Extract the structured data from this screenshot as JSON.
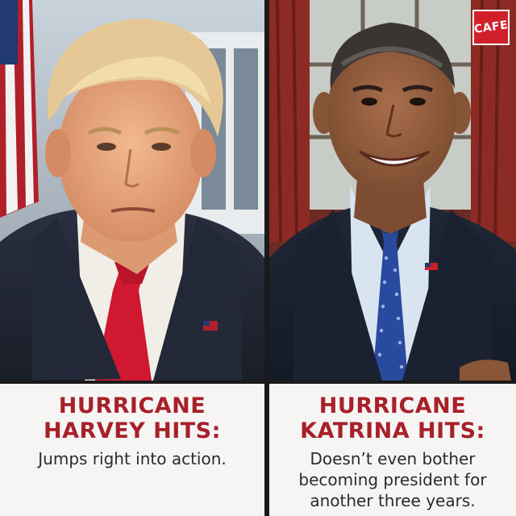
{
  "logo": {
    "text": "CAFE",
    "color": "#d0202a"
  },
  "panels": [
    {
      "headline_line1": "HURRICANE",
      "headline_line2": "HARVEY HITS:",
      "subtext": [
        "Jumps right into action."
      ]
    },
    {
      "headline_line1": "HURRICANE",
      "headline_line2": "KATRINA HITS:",
      "subtext": [
        "Doesn’t even bother",
        "becoming president for",
        "another three years."
      ]
    }
  ],
  "colors": {
    "headline": "#a8202a",
    "caption_bg": "#f6f5f4",
    "divider": "#1a1a1a"
  }
}
